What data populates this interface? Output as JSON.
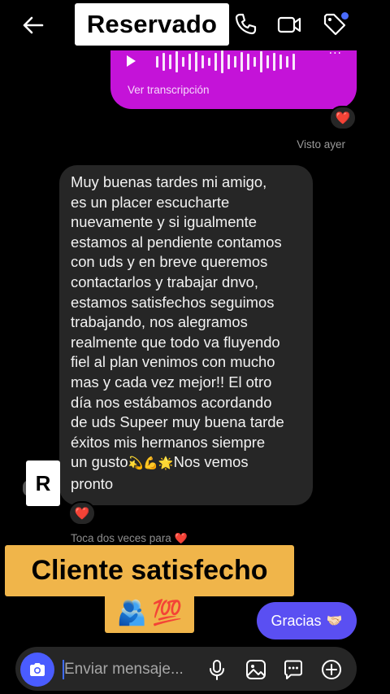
{
  "header": {
    "title": "Reservado",
    "icons": [
      "back-arrow-icon",
      "phone-icon",
      "video-icon",
      "tag-icon"
    ],
    "badge_color": "#4a6cff"
  },
  "thread": {
    "audio_message": {
      "transcript_link": "Ver transcripción",
      "dots": "···",
      "bubble_color": "#c413d8",
      "reaction": "❤️"
    },
    "seen_status": "Visto ayer",
    "received_message": {
      "text": "Muy buenas tardes mi amigo,\nes un placer escucharte\nnuevamente y si igualmente\nestamos al pendiente contamos\ncon uds y en breve queremos\ncontactarlos y trabajar dnvo,\nestamos satisfechos seguimos\ntrabajando, nos alegramos\nrealmente que todo va fluyendo\nfiel al plan venimos con mucho\nmas y cada vez mejor!! El otro\ndía nos estábamos acordando\nde uds Supeer muy buena tarde\néxitos mis hermanos siempre\nun gusto",
      "emojis": "💫💪🌟",
      "tail_text": "Nos vemos\npronto",
      "reaction": "❤️"
    },
    "avatar_letter": "R",
    "double_tap_hint": "Toca dos veces para",
    "double_tap_heart": "❤️",
    "overlay_label": "Cliente satisfecho",
    "overlay_emojis": [
      "🫂",
      "💯"
    ],
    "sent_message": {
      "text": "Gracias",
      "emoji": "🤝🏻",
      "bubble_color": "#5a4ff2"
    }
  },
  "composer": {
    "placeholder": "Enviar mensaje...",
    "icons": [
      "camera-icon",
      "microphone-icon",
      "gallery-icon",
      "sticker-icon",
      "add-icon"
    ],
    "camera_color": "#4a5cff"
  }
}
